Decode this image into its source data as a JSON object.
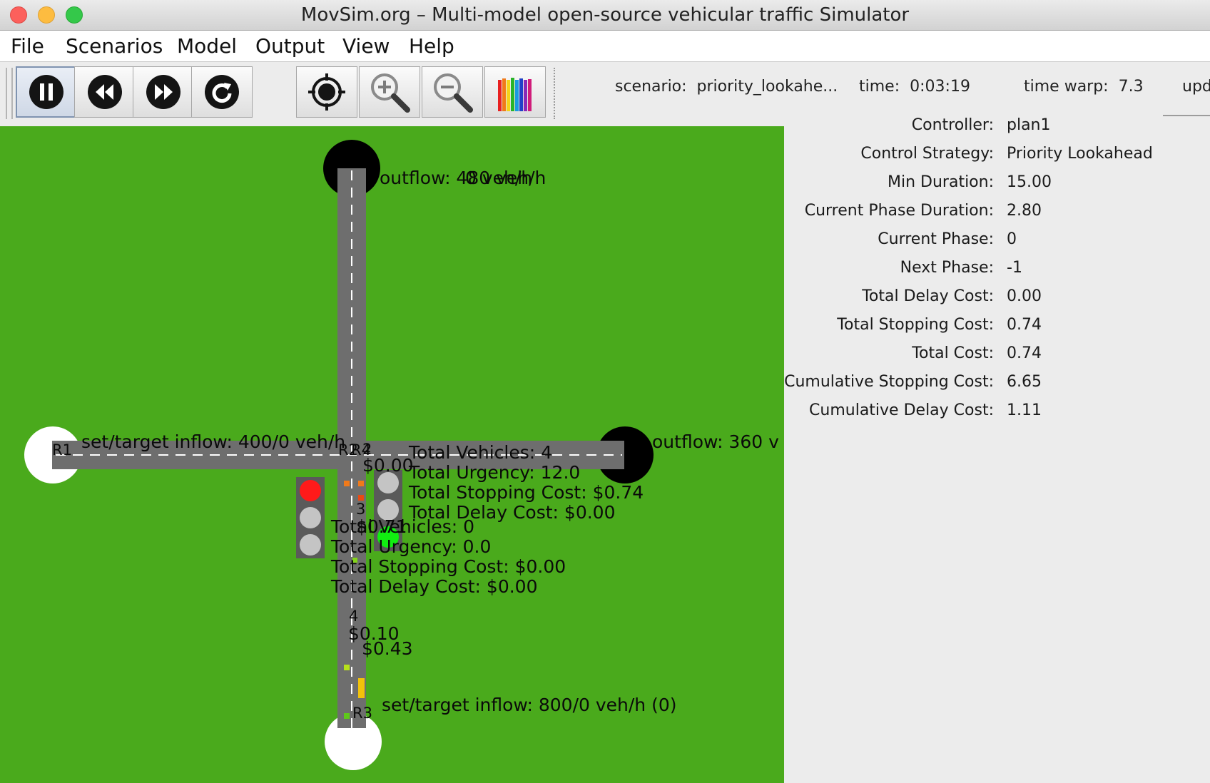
{
  "window": {
    "title": "MovSim.org – Multi-model open-source vehicular traffic Simulator"
  },
  "menu": [
    "File",
    "Scenarios",
    "Model",
    "Output",
    "View",
    "Help"
  ],
  "toolbar": {
    "buttons": [
      "pause-icon",
      "rewind-icon",
      "fast-forward-icon",
      "reset-icon",
      "center-target-icon",
      "zoom-in-icon",
      "zoom-out-icon",
      "color-pencils-icon"
    ],
    "scenario_label": "scenario:",
    "scenario_value": "priority_lookahe...",
    "time_label": "time:",
    "time_value": "0:03:19",
    "warp_label": "time warp:",
    "warp_value": "7.3",
    "update_label": "upd"
  },
  "simulation": {
    "road_labels": {
      "r1": "R1",
      "r2": "R2",
      "r4": "R4",
      "r3": "R3"
    },
    "north_outflow": "outflow: 480 veh/h",
    "north_outflow_overlap": "0 veh/h",
    "east_outflow": "outflow: 360 v",
    "west_inflow": "set/target inflow: 400/0 veh/h",
    "south_inflow": "set/target inflow: 800/0 veh/h (0)",
    "signal_2": {
      "id": "2",
      "cost": "$0.00",
      "lights": [
        "gray",
        "gray",
        "green"
      ],
      "stats": [
        "Total Vehicles: 4",
        "Total Urgency: 12.0",
        "Total Stopping Cost: $0.74",
        "Total Delay Cost: $0.00"
      ]
    },
    "signal_west": {
      "lights": [
        "red",
        "gray",
        "gray"
      ]
    },
    "signal_3": {
      "id": "3",
      "cost": "$0.71",
      "stats": [
        "Total Vehicles: 0",
        "Total Urgency: 0.0",
        "Total Stopping Cost: $0.00",
        "Total Delay Cost: $0.00"
      ]
    },
    "signal_4": {
      "id": "4",
      "cost": "$0.10"
    },
    "south_cost": "$0.43",
    "colors": {
      "grass": "#4aaa1c",
      "road": "#6e6e6e",
      "red": "#ff1a1a",
      "green": "#11ee11"
    }
  },
  "controller_panel": [
    {
      "key": "Controller:",
      "value": "plan1"
    },
    {
      "key": "Control Strategy:",
      "value": "Priority Lookahead"
    },
    {
      "key": "Min Duration:",
      "value": "15.00"
    },
    {
      "key": "Current Phase Duration:",
      "value": "2.80"
    },
    {
      "key": "Current Phase:",
      "value": "0"
    },
    {
      "key": "Next Phase:",
      "value": "-1"
    },
    {
      "key": "Total Delay Cost:",
      "value": "0.00"
    },
    {
      "key": "Total Stopping Cost:",
      "value": "0.74"
    },
    {
      "key": "Total Cost:",
      "value": "0.74"
    },
    {
      "key": "Cumulative Stopping Cost:",
      "value": "6.65"
    },
    {
      "key": "Cumulative Delay Cost:",
      "value": "1.11"
    }
  ]
}
